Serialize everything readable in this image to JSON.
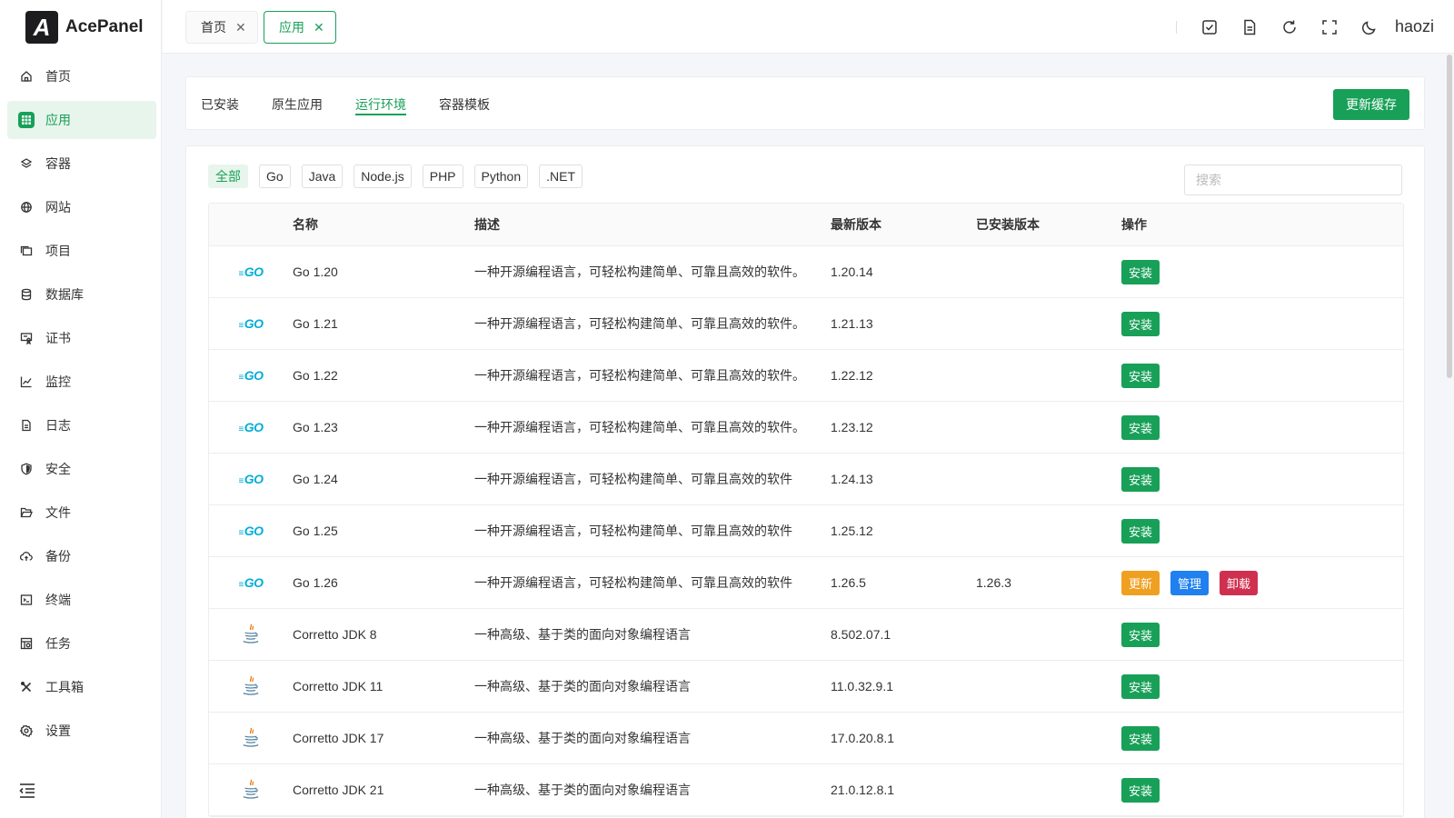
{
  "app": {
    "logo_mark": "A",
    "name": "AcePanel"
  },
  "colors": {
    "accent": "#18a058",
    "update": "#f0a020",
    "manage": "#2080f0",
    "uninstall": "#d03050"
  },
  "sidebar": {
    "items": [
      {
        "label": "首页",
        "icon": "home-icon"
      },
      {
        "label": "应用",
        "icon": "apps-grid-icon",
        "active": true
      },
      {
        "label": "容器",
        "icon": "layers-icon"
      },
      {
        "label": "网站",
        "icon": "globe-icon"
      },
      {
        "label": "项目",
        "icon": "folders-icon"
      },
      {
        "label": "数据库",
        "icon": "database-icon"
      },
      {
        "label": "证书",
        "icon": "certificate-icon"
      },
      {
        "label": "监控",
        "icon": "chart-icon"
      },
      {
        "label": "日志",
        "icon": "document-icon"
      },
      {
        "label": "安全",
        "icon": "shield-icon"
      },
      {
        "label": "文件",
        "icon": "folder-open-icon"
      },
      {
        "label": "备份",
        "icon": "cloud-backup-icon"
      },
      {
        "label": "终端",
        "icon": "terminal-icon"
      },
      {
        "label": "任务",
        "icon": "task-icon"
      },
      {
        "label": "工具箱",
        "icon": "tools-icon"
      },
      {
        "label": "设置",
        "icon": "gear-icon"
      }
    ]
  },
  "header": {
    "tabs": [
      {
        "label": "首页",
        "close": "✕"
      },
      {
        "label": "应用",
        "close": "✕",
        "active": true
      }
    ],
    "username": "haozi"
  },
  "app_tabs": {
    "items": [
      {
        "label": "已安装"
      },
      {
        "label": "原生应用"
      },
      {
        "label": "运行环境",
        "active": true
      },
      {
        "label": "容器模板"
      }
    ],
    "refresh_label": "更新缓存"
  },
  "filters": {
    "items": [
      {
        "label": "全部",
        "active": true
      },
      {
        "label": "Go"
      },
      {
        "label": "Java"
      },
      {
        "label": "Node.js"
      },
      {
        "label": "PHP"
      },
      {
        "label": "Python"
      },
      {
        "label": ".NET"
      }
    ],
    "search_placeholder": "搜索"
  },
  "table": {
    "columns": {
      "name": "名称",
      "desc": "描述",
      "latest": "最新版本",
      "installed": "已安装版本",
      "ops": "操作"
    },
    "go_logo_text": "GO",
    "rows": [
      {
        "type": "go",
        "name": "Go 1.20",
        "desc": "一种开源编程语言，可轻松构建简单、可靠且高效的软件。",
        "latest": "1.20.14",
        "installed": "",
        "ops": [
          {
            "kind": "install",
            "label": "安装"
          }
        ]
      },
      {
        "type": "go",
        "name": "Go 1.21",
        "desc": "一种开源编程语言，可轻松构建简单、可靠且高效的软件。",
        "latest": "1.21.13",
        "installed": "",
        "ops": [
          {
            "kind": "install",
            "label": "安装"
          }
        ]
      },
      {
        "type": "go",
        "name": "Go 1.22",
        "desc": "一种开源编程语言，可轻松构建简单、可靠且高效的软件。",
        "latest": "1.22.12",
        "installed": "",
        "ops": [
          {
            "kind": "install",
            "label": "安装"
          }
        ]
      },
      {
        "type": "go",
        "name": "Go 1.23",
        "desc": "一种开源编程语言，可轻松构建简单、可靠且高效的软件。",
        "latest": "1.23.12",
        "installed": "",
        "ops": [
          {
            "kind": "install",
            "label": "安装"
          }
        ]
      },
      {
        "type": "go",
        "name": "Go 1.24",
        "desc": "一种开源编程语言，可轻松构建简单、可靠且高效的软件",
        "latest": "1.24.13",
        "installed": "",
        "ops": [
          {
            "kind": "install",
            "label": "安装"
          }
        ]
      },
      {
        "type": "go",
        "name": "Go 1.25",
        "desc": "一种开源编程语言，可轻松构建简单、可靠且高效的软件",
        "latest": "1.25.12",
        "installed": "",
        "ops": [
          {
            "kind": "install",
            "label": "安装"
          }
        ]
      },
      {
        "type": "go",
        "name": "Go 1.26",
        "desc": "一种开源编程语言，可轻松构建简单、可靠且高效的软件",
        "latest": "1.26.5",
        "installed": "1.26.3",
        "ops": [
          {
            "kind": "update",
            "label": "更新"
          },
          {
            "kind": "manage",
            "label": "管理"
          },
          {
            "kind": "uninstall",
            "label": "卸载"
          }
        ]
      },
      {
        "type": "java",
        "name": "Corretto JDK 8",
        "desc": "一种高级、基于类的面向对象编程语言",
        "latest": "8.502.07.1",
        "installed": "",
        "ops": [
          {
            "kind": "install",
            "label": "安装"
          }
        ]
      },
      {
        "type": "java",
        "name": "Corretto JDK 11",
        "desc": "一种高级、基于类的面向对象编程语言",
        "latest": "11.0.32.9.1",
        "installed": "",
        "ops": [
          {
            "kind": "install",
            "label": "安装"
          }
        ]
      },
      {
        "type": "java",
        "name": "Corretto JDK 17",
        "desc": "一种高级、基于类的面向对象编程语言",
        "latest": "17.0.20.8.1",
        "installed": "",
        "ops": [
          {
            "kind": "install",
            "label": "安装"
          }
        ]
      },
      {
        "type": "java",
        "name": "Corretto JDK 21",
        "desc": "一种高级、基于类的面向对象编程语言",
        "latest": "21.0.12.8.1",
        "installed": "",
        "ops": [
          {
            "kind": "install",
            "label": "安装"
          }
        ]
      }
    ]
  }
}
